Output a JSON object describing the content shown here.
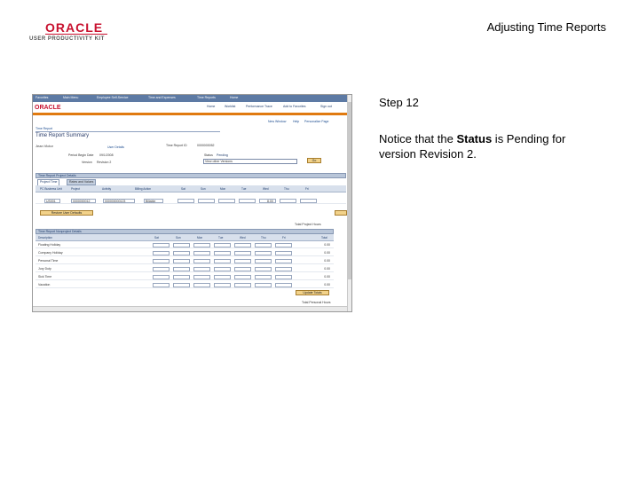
{
  "slide": {
    "brand_name": "ORACLE",
    "brand_sub": "USER PRODUCTIVITY KIT",
    "title": "Adjusting Time Reports",
    "step_title": "Step 12",
    "text_before": "Notice that the ",
    "text_bold": "Status",
    "text_after": " is Pending for version Revision 2."
  },
  "colors": {
    "brand_red": "#c8102e",
    "menubar": "#5d7aa4",
    "accent_orange": "#e07a10"
  },
  "screenshot": {
    "menu": [
      "Favorites",
      "Main Menu",
      "Employee Self-Service",
      "Time and Expenses",
      "Time Reports",
      "Home"
    ],
    "app_logo": "ORACLE",
    "top_links": [
      "Home",
      "Worklist",
      "Performance Trace",
      "Add to Favorites",
      "Sign out"
    ],
    "page_links": [
      "New Window",
      "Help",
      "Personalize Page"
    ],
    "breadcrumb": "Time Report",
    "page_title": "Time Report Summary",
    "user": "Jean Victor",
    "user_details_link": "User Details",
    "period_label": "Period Begin Date",
    "period_value": "09/1/2008",
    "report_id_label": "Time Report ID",
    "report_id_value": "0000003052",
    "version_label": "Version",
    "version_value": "Revision 2",
    "status_label": "Status",
    "status_value": "Pending",
    "view_select": "View other Versions",
    "go_button": "Go",
    "project_section": "Time Report Project Details",
    "tabs": [
      "Project Time",
      "Rates and Values"
    ],
    "project_columns": [
      "PC Business Unit",
      "Project",
      "Activity",
      "Billing Action",
      "Sat",
      "Sun",
      "Mon",
      "Tue",
      "Wed",
      "Thu",
      "Fri"
    ],
    "project_row": {
      "bu": "US001",
      "project": "0000000012",
      "activity": "000000000123",
      "billing": "Billable",
      "wed": "8.00"
    },
    "restore_button": "Restore User Defaults",
    "project_total_label": "Total Project Hours",
    "nonproject_section": "Time Report Nonproject Details",
    "nonproject_columns": [
      "Description",
      "Sat",
      "Sun",
      "Mon",
      "Tue",
      "Wed",
      "Thu",
      "Fri",
      "Total"
    ],
    "nonproject_rows": [
      {
        "label": "Floating Holiday",
        "total": "0.00"
      },
      {
        "label": "Company Holiday",
        "total": "0.00"
      },
      {
        "label": "Personal Time",
        "total": "0.00"
      },
      {
        "label": "Jury Duty",
        "total": "0.00"
      },
      {
        "label": "Sick Time",
        "total": "0.00"
      },
      {
        "label": "Vacation",
        "total": "0.00"
      }
    ],
    "update_button": "Update Totals",
    "nonproject_total_label": "Total Personal Hours"
  }
}
